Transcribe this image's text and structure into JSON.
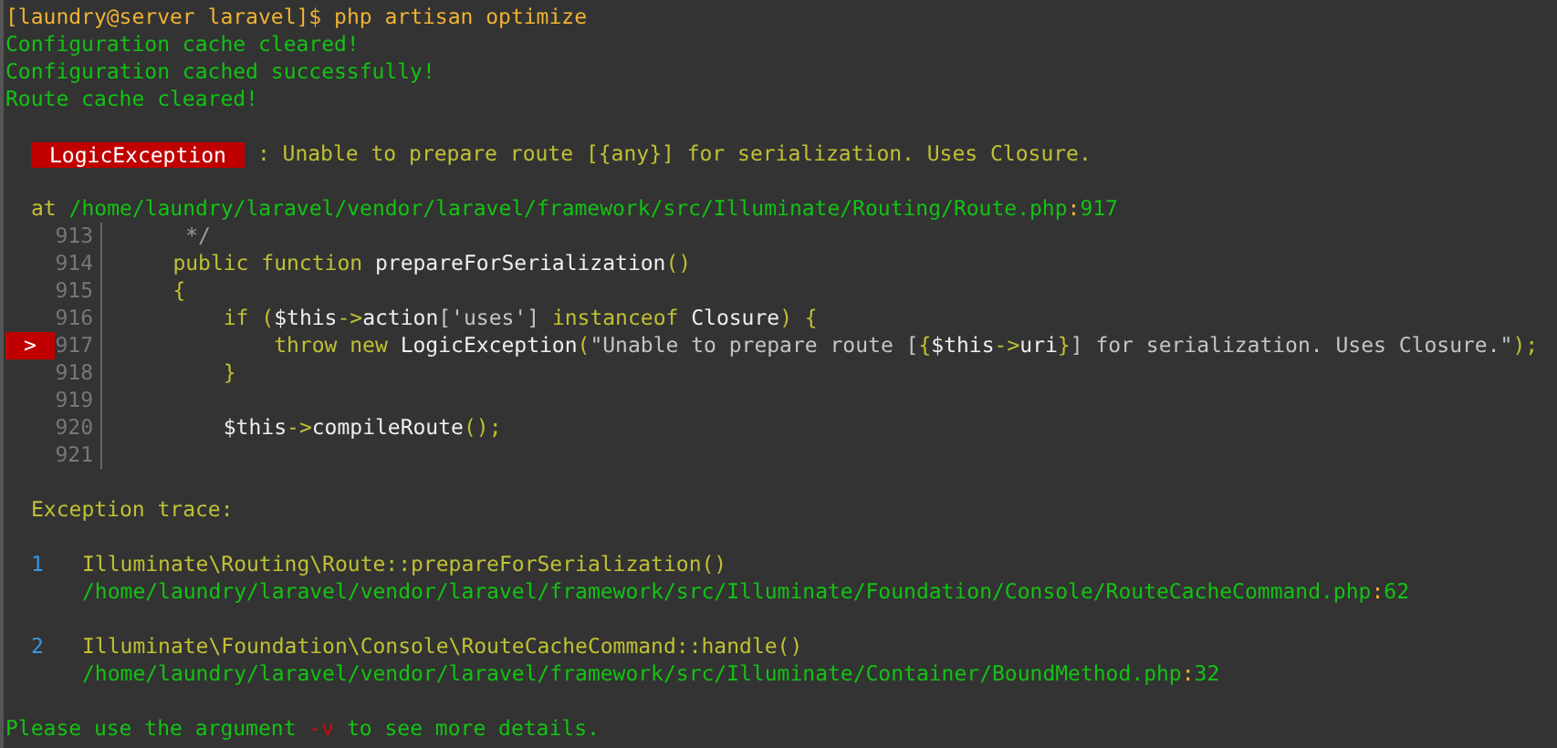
{
  "prompt": {
    "user_host": "[laundry@server laravel]$",
    "command": "php artisan optimize"
  },
  "output_lines": [
    "Configuration cache cleared!",
    "Configuration cached successfully!",
    "Route cache cleared!"
  ],
  "exception": {
    "class": "LogicException",
    "message": ": Unable to prepare route [{any}] for serialization. Uses Closure."
  },
  "location": {
    "at": "at",
    "path": "/home/laundry/laravel/vendor/laravel/framework/src/Illuminate/Routing/Route.php",
    "separator": ":",
    "line": "917"
  },
  "snippet": {
    "pointer": ">",
    "lines": [
      {
        "number": "913",
        "highlighted": false,
        "tokens": [
          {
            "kind": "comment",
            "text": "     */"
          }
        ]
      },
      {
        "number": "914",
        "highlighted": false,
        "tokens": [
          {
            "kind": "keyword",
            "text": "    public function "
          },
          {
            "kind": "name",
            "text": "prepareForSerialization"
          },
          {
            "kind": "punct",
            "text": "()"
          }
        ]
      },
      {
        "number": "915",
        "highlighted": false,
        "tokens": [
          {
            "kind": "punct",
            "text": "    {"
          }
        ]
      },
      {
        "number": "916",
        "highlighted": false,
        "tokens": [
          {
            "kind": "keyword",
            "text": "        if ("
          },
          {
            "kind": "name",
            "text": "$this"
          },
          {
            "kind": "punct",
            "text": "->"
          },
          {
            "kind": "name",
            "text": "action"
          },
          {
            "kind": "string",
            "text": "['uses'] "
          },
          {
            "kind": "keyword",
            "text": "instanceof "
          },
          {
            "kind": "name",
            "text": "Closure"
          },
          {
            "kind": "punct",
            "text": ") {"
          }
        ]
      },
      {
        "number": "917",
        "highlighted": true,
        "tokens": [
          {
            "kind": "keyword",
            "text": "            throw new "
          },
          {
            "kind": "name",
            "text": "LogicException"
          },
          {
            "kind": "punct",
            "text": "("
          },
          {
            "kind": "string",
            "text": "\"Unable to prepare route ["
          },
          {
            "kind": "punct",
            "text": "{"
          },
          {
            "kind": "name",
            "text": "$this"
          },
          {
            "kind": "punct",
            "text": "->"
          },
          {
            "kind": "name",
            "text": "uri"
          },
          {
            "kind": "punct",
            "text": "}"
          },
          {
            "kind": "string",
            "text": "] for serialization. Uses Closure.\""
          },
          {
            "kind": "punct",
            "text": ");"
          }
        ]
      },
      {
        "number": "918",
        "highlighted": false,
        "tokens": [
          {
            "kind": "punct",
            "text": "        }"
          }
        ]
      },
      {
        "number": "919",
        "highlighted": false
      },
      {
        "number": "920",
        "highlighted": false,
        "tokens": [
          {
            "kind": "name",
            "text": "        $this"
          },
          {
            "kind": "punct",
            "text": "->"
          },
          {
            "kind": "name",
            "text": "compileRoute"
          },
          {
            "kind": "punct",
            "text": "();"
          }
        ]
      },
      {
        "number": "921",
        "highlighted": false
      }
    ]
  },
  "trace": {
    "title": "Exception trace:",
    "frames": [
      {
        "index": "1",
        "call": "Illuminate\\Routing\\Route::prepareForSerialization()",
        "path": "/home/laundry/laravel/vendor/laravel/framework/src/Illuminate/Foundation/Console/RouteCacheCommand.php",
        "separator": ":",
        "line": "62"
      },
      {
        "index": "2",
        "call": "Illuminate\\Foundation\\Console\\RouteCacheCommand::handle()",
        "path": "/home/laundry/laravel/vendor/laravel/framework/src/Illuminate/Container/BoundMethod.php",
        "separator": ":",
        "line": "32"
      }
    ]
  },
  "hint": {
    "before": "Please use the argument ",
    "flag": "-v",
    "after": " to see more details."
  }
}
